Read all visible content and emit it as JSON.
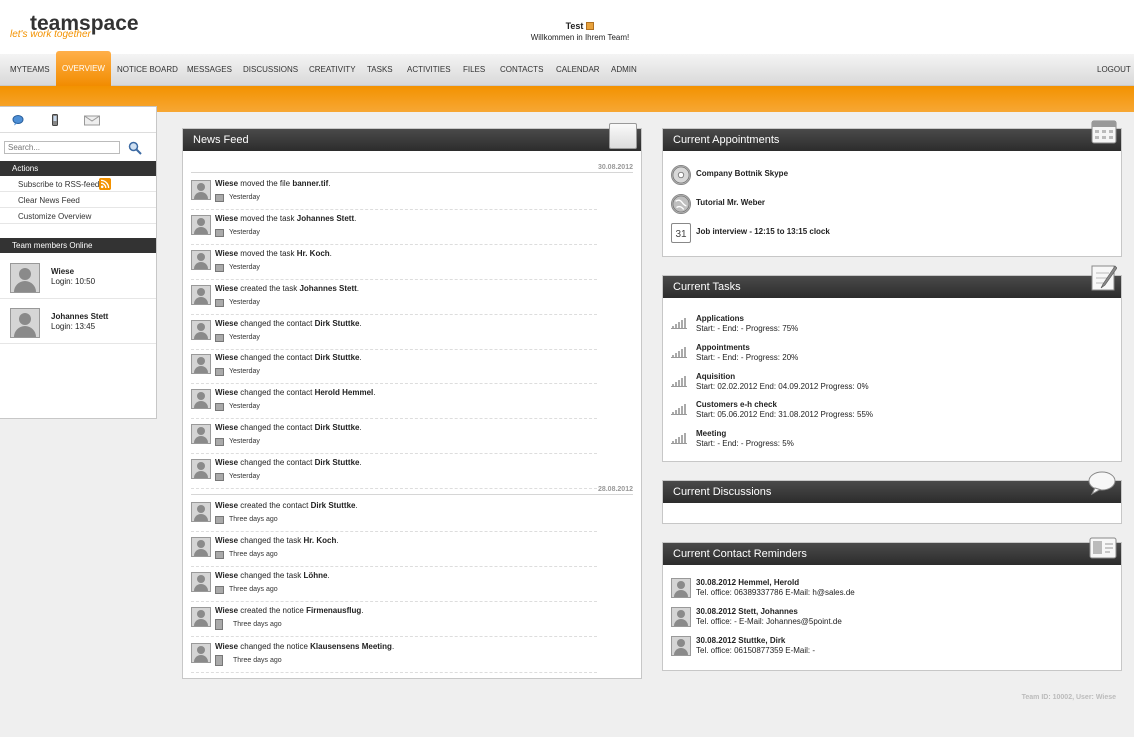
{
  "header": {
    "logo_text": "teamspace",
    "logo_tagline": "let's work together",
    "user_name": "Test",
    "welcome_message": "Willkommen in Ihrem Team!"
  },
  "nav": {
    "items": [
      "MYTEAMS",
      "OVERVIEW",
      "NOTICE BOARD",
      "MESSAGES",
      "DISCUSSIONS",
      "CREATIVITY",
      "TASKS",
      "ACTIVITIES",
      "FILES",
      "CONTACTS",
      "CALENDAR",
      "ADMIN"
    ],
    "active": "OVERVIEW",
    "logout": "LOGOUT"
  },
  "sidebar": {
    "search_placeholder": "Search...",
    "actions_title": "Actions",
    "actions": [
      "Subscribe to RSS-feed",
      "Clear News Feed",
      "Customize Overview"
    ],
    "members_title": "Team members Online",
    "members": [
      {
        "name": "Wiese",
        "login": "Login:   10:50"
      },
      {
        "name": "Johannes Stett",
        "login": "Login:   13:45"
      }
    ]
  },
  "news_feed": {
    "title": "News Feed",
    "date1": "30.08.2012",
    "date2": "28.08.2012",
    "items": [
      {
        "user": "Wiese",
        "action": " moved the file ",
        "object": "banner.tif",
        "suffix": ".",
        "time": "Yesterday",
        "kind": "file"
      },
      {
        "user": "Wiese",
        "action": " moved the task ",
        "object": "Johannes Stett",
        "suffix": ".",
        "time": "Yesterday",
        "kind": "task"
      },
      {
        "user": "Wiese",
        "action": " moved the task ",
        "object": "Hr. Koch",
        "suffix": ".",
        "time": "Yesterday",
        "kind": "task"
      },
      {
        "user": "Wiese",
        "action": " created the task ",
        "object": "Johannes Stett",
        "suffix": ".",
        "time": "Yesterday",
        "kind": "task"
      },
      {
        "user": "Wiese",
        "action": " changed the contact ",
        "object": "Dirk Stuttke",
        "suffix": ".",
        "time": "Yesterday",
        "kind": "contact"
      },
      {
        "user": "Wiese",
        "action": " changed the contact ",
        "object": "Dirk Stuttke",
        "suffix": ".",
        "time": "Yesterday",
        "kind": "contact"
      },
      {
        "user": "Wiese",
        "action": " changed the contact ",
        "object": "Herold Hemmel",
        "suffix": ".",
        "time": "Yesterday",
        "kind": "contact"
      },
      {
        "user": "Wiese",
        "action": " changed the contact ",
        "object": "Dirk Stuttke",
        "suffix": ".",
        "time": "Yesterday",
        "kind": "contact"
      },
      {
        "user": "Wiese",
        "action": " changed the contact ",
        "object": "Dirk Stuttke",
        "suffix": ".",
        "time": "Yesterday",
        "kind": "contact"
      },
      {
        "user": "Wiese",
        "action": " created the contact ",
        "object": "Dirk Stuttke",
        "suffix": ".",
        "time": "Three days ago",
        "kind": "contact"
      },
      {
        "user": "Wiese",
        "action": " changed the task ",
        "object": "Hr. Koch",
        "suffix": ".",
        "time": "Three days ago",
        "kind": "task"
      },
      {
        "user": "Wiese",
        "action": " changed the task ",
        "object": "Löhne",
        "suffix": ".",
        "time": "Three days ago",
        "kind": "task"
      },
      {
        "user": "Wiese",
        "action": " created the notice ",
        "object": "Firmenausflug",
        "suffix": ".",
        "time": "Three days ago",
        "kind": "note"
      },
      {
        "user": "Wiese",
        "action": " changed the notice ",
        "object": "Klausensens Meeting",
        "suffix": ".",
        "time": "Three days ago",
        "kind": "note"
      }
    ]
  },
  "appointments": {
    "title": "Current Appointments",
    "items": [
      "Company Bottnik Skype",
      "Tutorial Mr. Weber",
      "Job interview - 12:15 to 13:15 clock"
    ],
    "calendar_day": "31"
  },
  "tasks": {
    "title": "Current Tasks",
    "items": [
      {
        "name": "Applications",
        "meta": "Start: -    End: -    Progress: 75%",
        "progress": 75
      },
      {
        "name": "Appointments",
        "meta": "Start: -    End: -    Progress: 20%",
        "progress": 20
      },
      {
        "name": "Aquisition",
        "meta": "Start: 02.02.2012    End: 04.09.2012    Progress: 0%",
        "progress": 0
      },
      {
        "name": "Customers e-h check",
        "meta": "Start: 05.06.2012    End: 31.08.2012    Progress: 55%",
        "progress": 55
      },
      {
        "name": "Meeting",
        "meta": "Start: -    End: -    Progress: 5%",
        "progress": 5
      }
    ]
  },
  "discussions": {
    "title": "Current Discussions"
  },
  "contacts": {
    "title": "Current Contact Reminders",
    "items": [
      {
        "name": "30.08.2012    Hemmel, Herold",
        "meta": "Tel. office: 06389337786    E-Mail: h@sales.de"
      },
      {
        "name": "30.08.2012    Stett, Johannes",
        "meta": "Tel. office: -    E-Mail: Johannes@5point.de"
      },
      {
        "name": "30.08.2012    Stuttke, Dirk",
        "meta": "Tel. office: 06150877359    E-Mail: -"
      }
    ]
  },
  "footer": {
    "team_info": "Team ID: 10002, User: Wiese"
  },
  "colors": {
    "accent": "#f39200",
    "header_bar": "#333333"
  }
}
